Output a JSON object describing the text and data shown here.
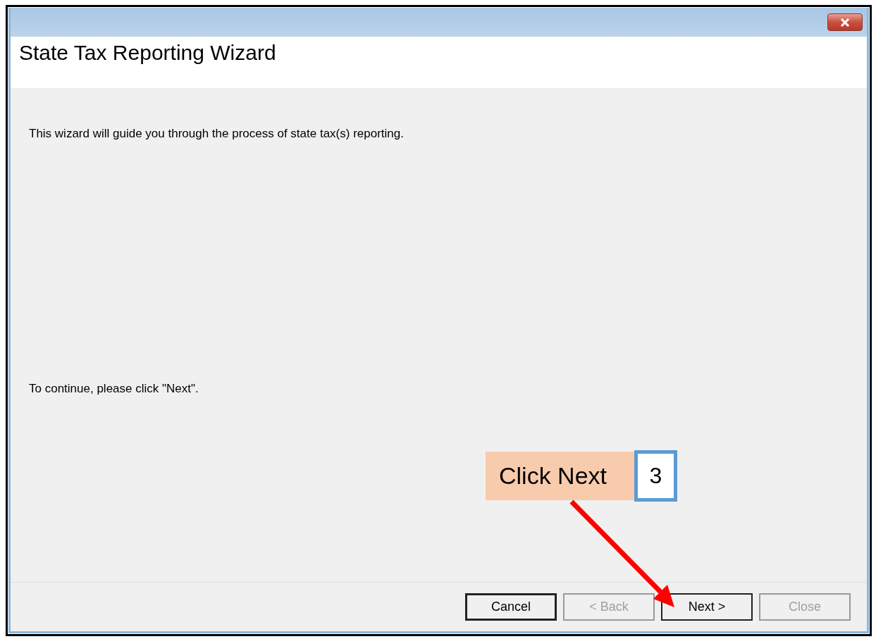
{
  "window": {
    "title": "State Tax Reporting Wizard"
  },
  "body": {
    "intro": "This wizard will guide you through the process of state tax(s) reporting.",
    "instruction": "To continue, please click \"Next\"."
  },
  "buttons": [
    {
      "label": "Cancel",
      "disabled": false,
      "default": true
    },
    {
      "label": "< Back",
      "disabled": true,
      "default": false
    },
    {
      "label": "Next >",
      "disabled": false,
      "default": false
    },
    {
      "label": "Close",
      "disabled": true,
      "default": false
    }
  ],
  "callout": {
    "text": "Click Next",
    "step": "3"
  }
}
